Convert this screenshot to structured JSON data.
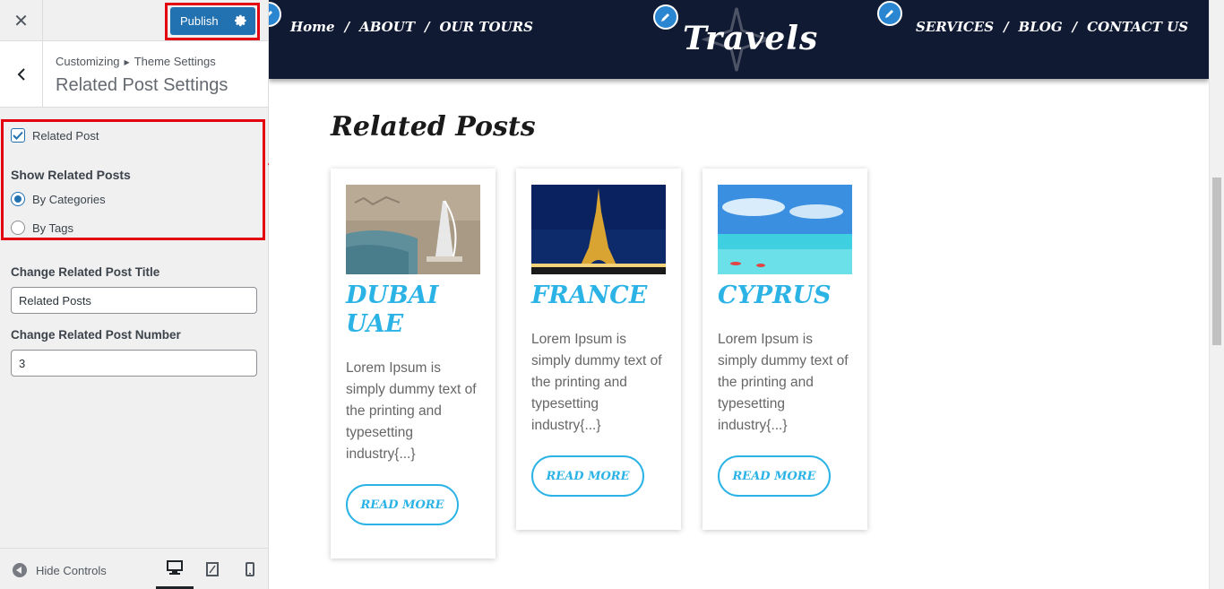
{
  "sidebar": {
    "close_label": "✕",
    "publish_label": "Publish",
    "breadcrumb": {
      "parent": "Customizing",
      "child": "Theme Settings"
    },
    "section_title": "Related Post Settings",
    "related_post_checkbox": {
      "label": "Related Post",
      "checked": true
    },
    "show_related_label": "Show Related Posts",
    "radio_options": [
      {
        "label": "By Categories",
        "selected": true
      },
      {
        "label": "By Tags",
        "selected": false
      }
    ],
    "title_field": {
      "label": "Change Related Post Title",
      "value": "Related Posts"
    },
    "number_field": {
      "label": "Change Related Post Number",
      "value": "3"
    },
    "footer": {
      "hide_controls_label": "Hide Controls",
      "devices": [
        "desktop",
        "tablet",
        "mobile"
      ],
      "active_device": "desktop"
    }
  },
  "site": {
    "nav_left": [
      "Home",
      "ABOUT",
      "OUR TOURS"
    ],
    "nav_right": [
      "SERVICES",
      "BLOG",
      "CONTACT US"
    ],
    "logo_text": "Travels",
    "related_title": "Related Posts",
    "posts": [
      {
        "title_line1": "DUBAI",
        "title_line2": "UAE",
        "excerpt": "Lorem Ipsum is simply dummy text of the printing and typesetting industry{...}",
        "button": "READ MORE"
      },
      {
        "title_line1": "FRANCE",
        "title_line2": "",
        "excerpt": "Lorem Ipsum is simply dummy text of the printing and typesetting industry{...}",
        "button": "READ MORE"
      },
      {
        "title_line1": "CYPRUS",
        "title_line2": "",
        "excerpt": "Lorem Ipsum is simply dummy text of the printing and typesetting industry{...}",
        "button": "READ MORE"
      }
    ]
  },
  "colors": {
    "accent": "#2271b1",
    "header_bg": "#101a33",
    "card_title": "#2bb3e6",
    "highlight": "#e3000f"
  }
}
